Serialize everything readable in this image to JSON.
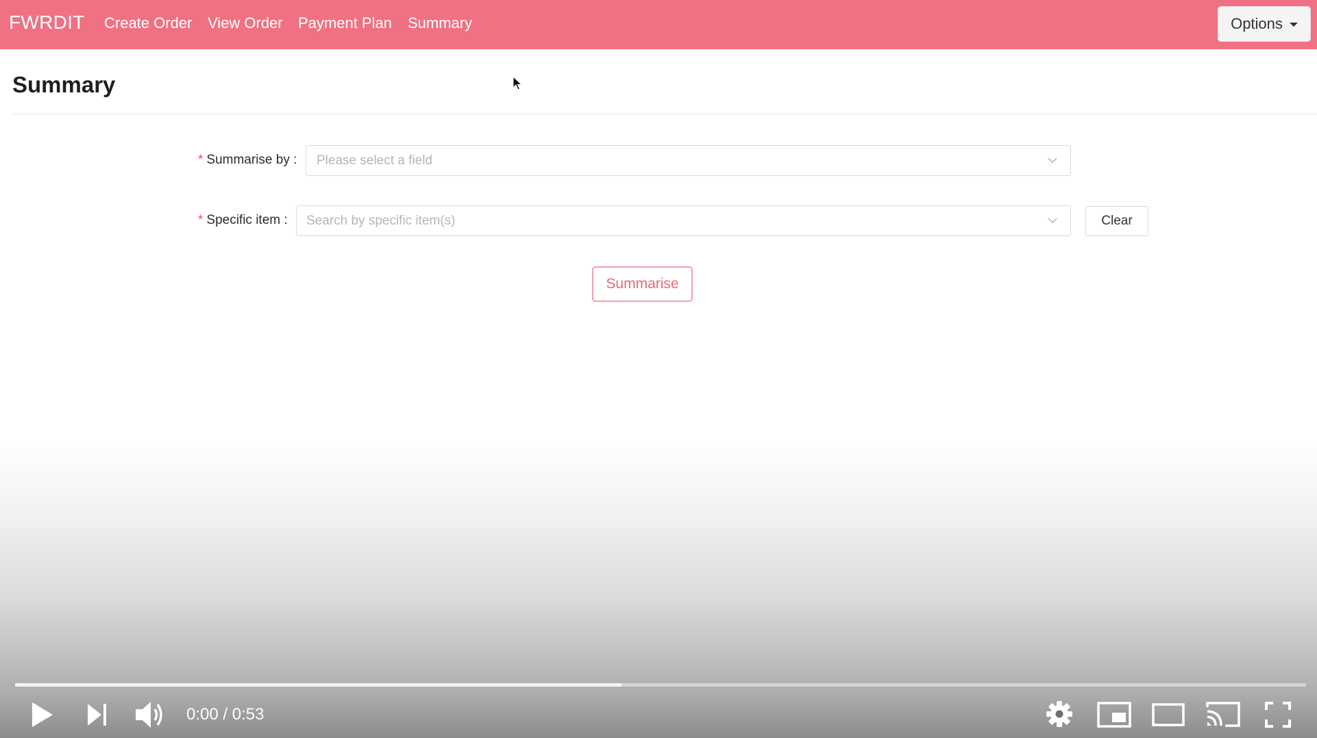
{
  "navbar": {
    "brand": "FWRDIT",
    "links": [
      "Create Order",
      "View Order",
      "Payment Plan",
      "Summary"
    ],
    "options_label": "Options"
  },
  "page": {
    "title": "Summary"
  },
  "form": {
    "summarise_by": {
      "required_mark": "*",
      "label": "Summarise by :",
      "placeholder": "Please select a field"
    },
    "specific_item": {
      "required_mark": "*",
      "label": "Specific item :",
      "placeholder": "Search by specific item(s)"
    },
    "clear_label": "Clear",
    "summarise_label": "Summarise"
  },
  "video": {
    "time": "0:00 / 0:53",
    "loaded_fraction": 0.47,
    "icons": [
      "play-icon",
      "next-icon",
      "volume-icon",
      "settings-icon",
      "miniplayer-icon",
      "theater-icon",
      "cast-icon",
      "fullscreen-icon"
    ]
  },
  "colors": {
    "navbar": "#ef7183",
    "accent": "#e8677a",
    "required": "#f0506e"
  }
}
